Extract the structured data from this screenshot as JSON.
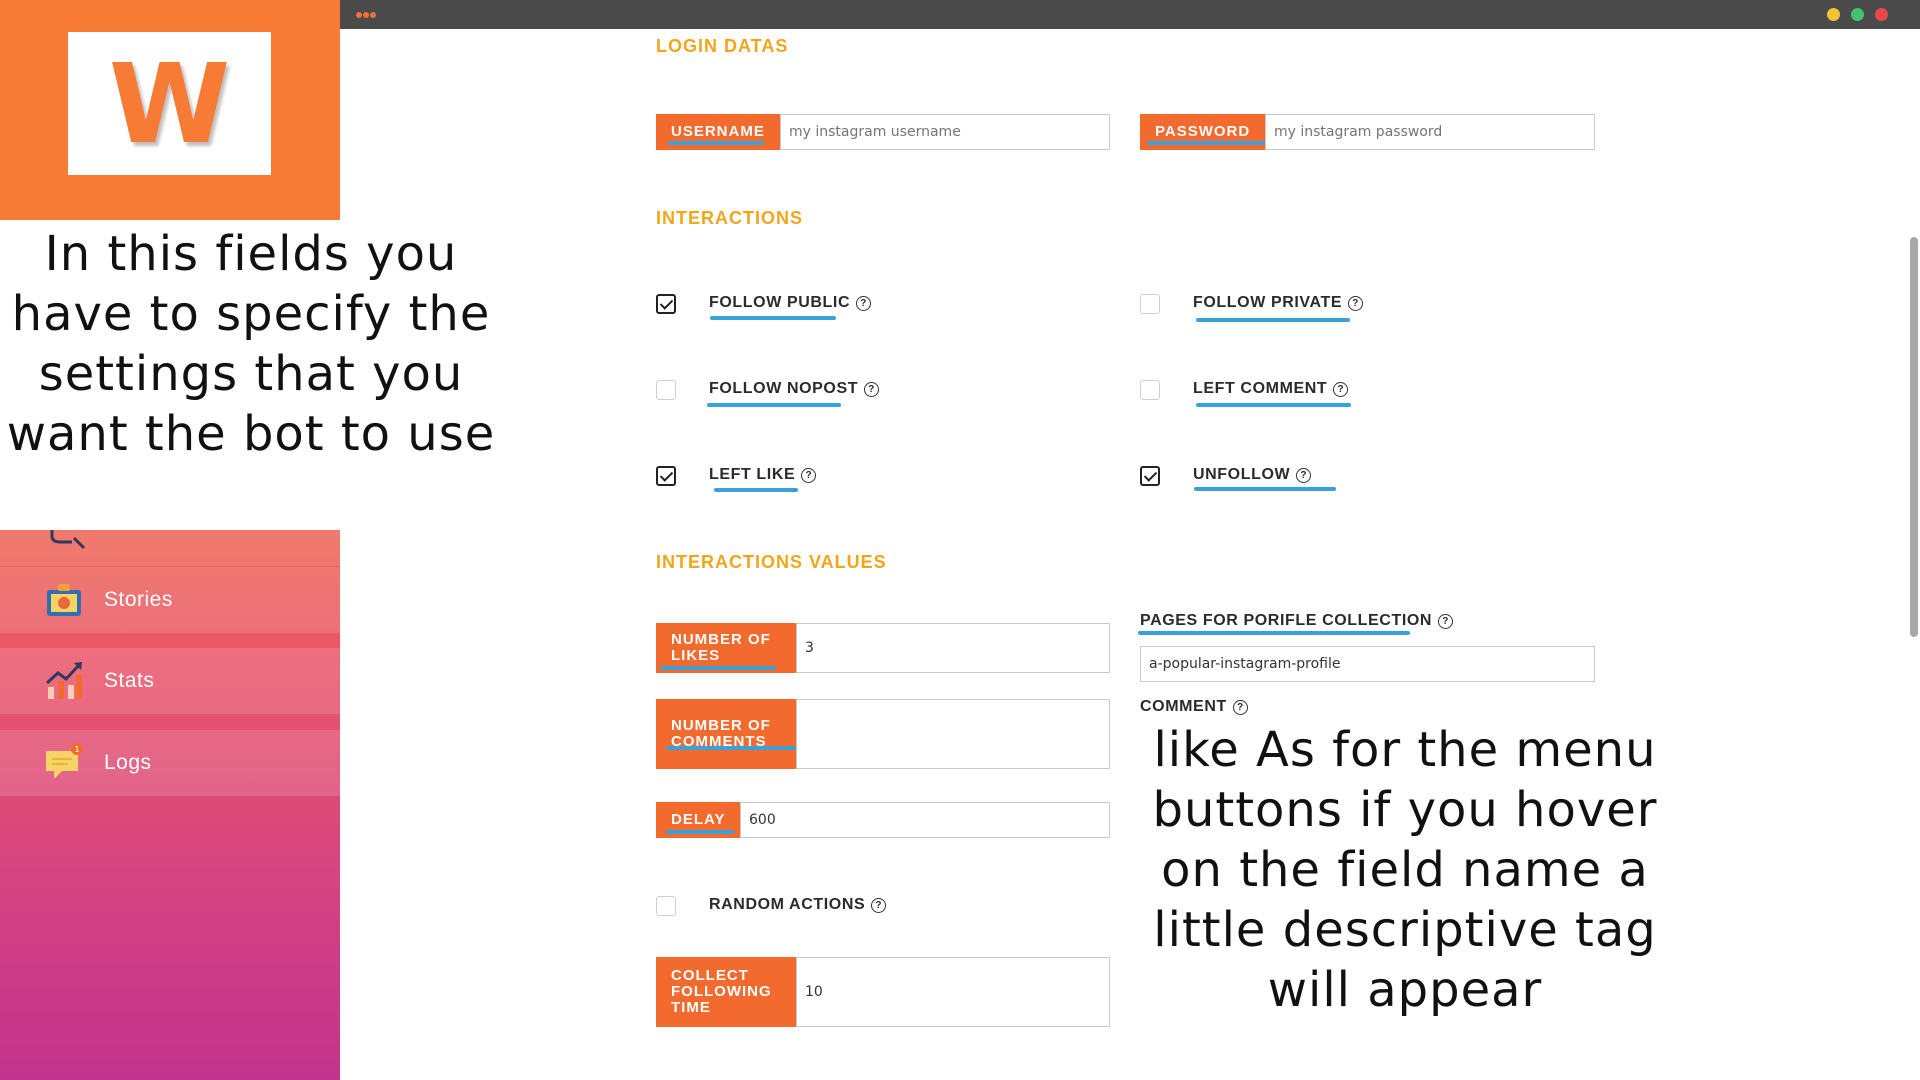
{
  "app": {
    "logo_letter": "W",
    "accent_color": "#f36a2f",
    "section_color": "#f3a51a"
  },
  "sidebar": {
    "items": [
      {
        "label": "Stories",
        "icon": "stories-icon"
      },
      {
        "label": "Stats",
        "icon": "stats-icon"
      },
      {
        "label": "Logs",
        "icon": "logs-icon",
        "badge": "1"
      }
    ]
  },
  "captions": {
    "left": "In this fields you have to specify the settings that you want the bot to use",
    "right": "like As for the menu buttons if you hover on the field name a little descriptive tag will appear"
  },
  "form": {
    "login_title": "LOGIN DATAS",
    "username_label": "USERNAME",
    "username_placeholder": "my instagram username",
    "password_label": "PASSWORD",
    "password_placeholder": "my instagram password",
    "interactions_title": "INTERACTIONS",
    "interactions": [
      {
        "label": "FOLLOW PUBLIC",
        "checked": true
      },
      {
        "label": "FOLLOW PRIVATE",
        "checked": false
      },
      {
        "label": "FOLLOW NOPOST",
        "checked": false
      },
      {
        "label": "LEFT COMMENT",
        "checked": false
      },
      {
        "label": "LEFT LIKE",
        "checked": true
      },
      {
        "label": "UNFOLLOW",
        "checked": true
      }
    ],
    "values_title": "INTERACTIONS VALUES",
    "likes_label": "NUMBER OF LIKES",
    "likes_value": "3",
    "comments_label": "NUMBER OF COMMENTS",
    "comments_value": "",
    "delay_label": "DELAY",
    "delay_value": "600",
    "random_label": "RANDOM ACTIONS",
    "random_checked": false,
    "collect_label": "COLLECT FOLLOWING TIME",
    "collect_value": "10",
    "pages_label": "PAGES FOR PORIFLE COLLECTION",
    "pages_value": "a-popular-instagram-profile",
    "comment_label": "COMMENT",
    "help_glyph": "?"
  }
}
